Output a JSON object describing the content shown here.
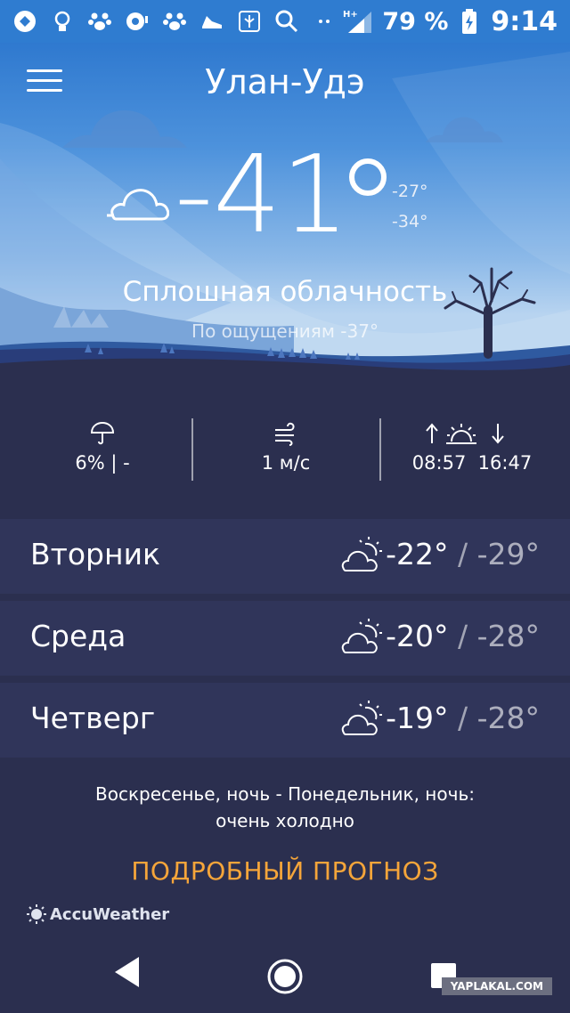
{
  "status_bar": {
    "icons": [
      "app-icon",
      "bulb-icon",
      "paw-icon",
      "record-icon",
      "paw-icon",
      "shoe-icon",
      "usb-icon",
      "search-icon",
      "more-dots-icon",
      "hplus-signal-icon"
    ],
    "network_label": "H+",
    "battery_percent": "79 %",
    "time": "9:14"
  },
  "header": {
    "city": "Улан-Удэ",
    "menu_icon": "hamburger-menu-icon"
  },
  "current": {
    "temperature": "-41",
    "high": "-27°",
    "low": "-34°",
    "condition": "Сплошная облачность",
    "feels_like": "По ощущениям -37°",
    "icon": "cloud-icon"
  },
  "stats": {
    "precipitation": {
      "icon": "umbrella-icon",
      "value": "6% | -"
    },
    "wind": {
      "icon": "wind-icon",
      "value": "1 м/с"
    },
    "sun": {
      "icon": "sunrise-sunset-icon",
      "sunrise": "08:57",
      "sunset": "16:47"
    }
  },
  "forecast": [
    {
      "day": "Вторник",
      "high": "-22°",
      "low": "-29°",
      "icon": "partly-cloudy-icon"
    },
    {
      "day": "Среда",
      "high": "-20°",
      "low": "-28°",
      "icon": "partly-cloudy-icon"
    },
    {
      "day": "Четверг",
      "high": "-19°",
      "low": "-28°",
      "icon": "partly-cloudy-icon"
    }
  ],
  "notice": {
    "line1": "Воскресенье, ночь - Понедельник, ночь:",
    "line2": "очень холодно"
  },
  "detail_link": "ПОДРОБНЫЙ ПРОГНОЗ",
  "brand": "AccuWeather",
  "watermark": "YAPLAKAL.COM",
  "colors": {
    "status_bar": "#2f7cd0",
    "background": "#2b2f4f",
    "card": "#30355a",
    "accent": "#f5a53a"
  }
}
